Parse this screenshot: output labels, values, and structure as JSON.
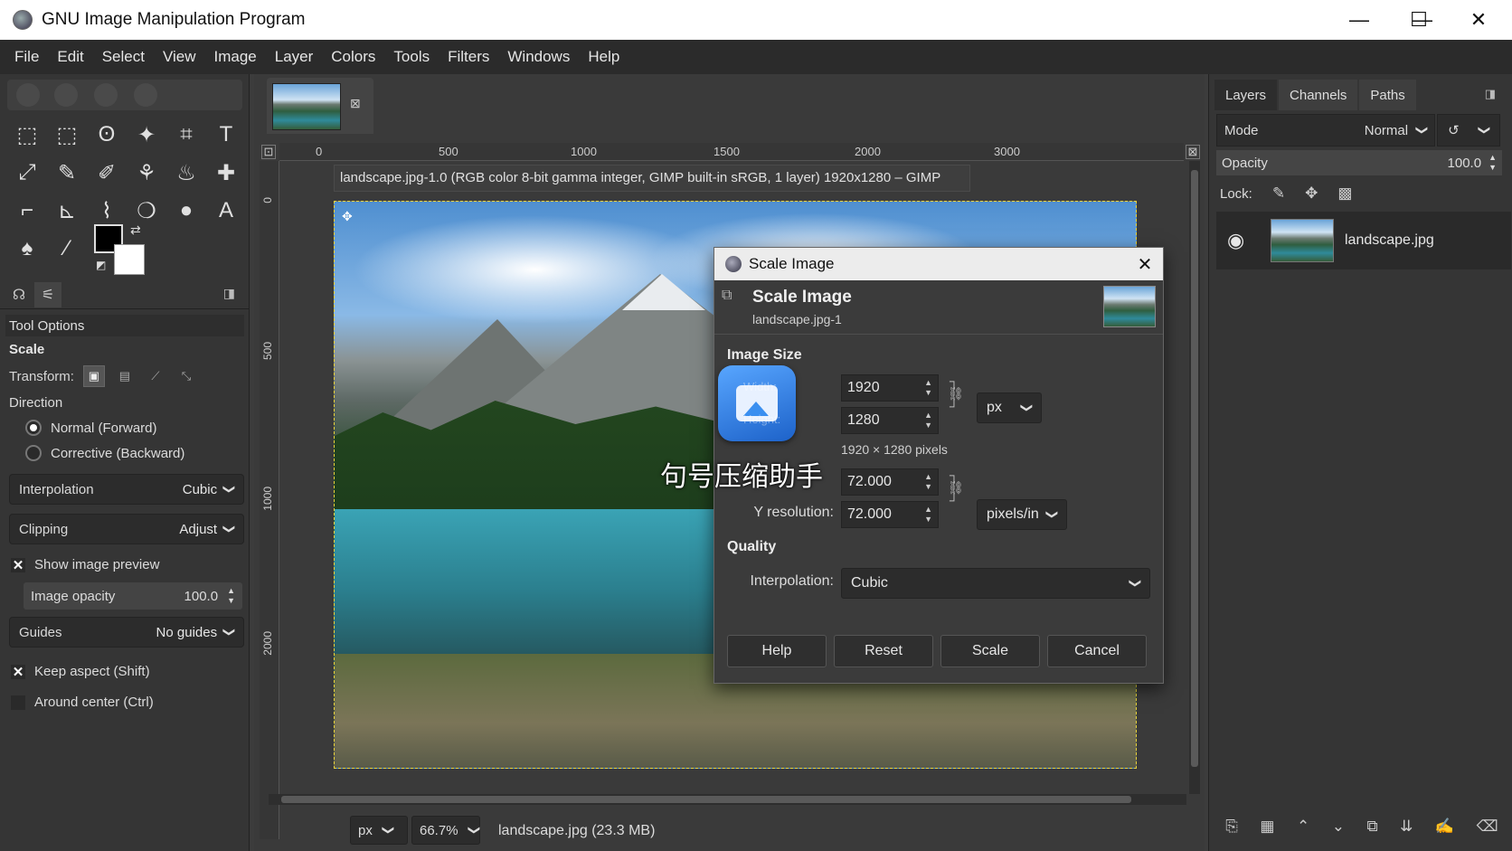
{
  "window": {
    "title": "GNU Image Manipulation Program",
    "controls": [
      "—",
      "☐",
      "✕"
    ]
  },
  "menu": [
    "File",
    "Edit",
    "Select",
    "View",
    "Image",
    "Layer",
    "Colors",
    "Tools",
    "Filters",
    "Windows",
    "Help"
  ],
  "tools": [
    "⬚",
    "⬚",
    "ʘ",
    "✦",
    "⌗",
    "T",
    "⤢",
    "✎",
    "✐",
    "⚘",
    "♨",
    "✚",
    "⌐",
    "⊾",
    "⌇",
    "❍",
    "●",
    "A",
    "♠",
    "⁄"
  ],
  "tool_options": {
    "header": "Tool Options",
    "title": "Scale",
    "transform_label": "Transform:",
    "direction_label": "Direction",
    "direction_normal": "Normal (Forward)",
    "direction_corrective": "Corrective (Backward)",
    "interpolation_label": "Interpolation",
    "interpolation_value": "Cubic",
    "clipping_label": "Clipping",
    "clipping_value": "Adjust",
    "show_preview": "Show image preview",
    "image_opacity_label": "Image opacity",
    "image_opacity_value": "100.0",
    "guides_label": "Guides",
    "guides_value": "No guides",
    "keep_aspect": "Keep aspect (Shift)",
    "around_center": "Around center (Ctrl)"
  },
  "image_window": {
    "info": "landscape.jpg-1.0 (RGB color 8-bit gamma integer, GIMP built-in sRGB, 1 layer) 1920x1280 – GIMP",
    "ruler_h": [
      "0",
      "500",
      "1000",
      "1500",
      "2000",
      "3000"
    ],
    "ruler_v": [
      "0",
      "500",
      "1000",
      "2000"
    ],
    "unit": "px",
    "zoom": "66.7%",
    "status": "landscape.jpg (23.3 MB)"
  },
  "layers_panel": {
    "tabs": [
      "Layers",
      "Channels",
      "Paths"
    ],
    "mode_label": "Mode",
    "mode_value": "Normal",
    "opacity_label": "Opacity",
    "opacity_value": "100.0",
    "lock_label": "Lock:",
    "layer_name": "landscape.jpg"
  },
  "dialog": {
    "window_title": "Scale Image",
    "header_title": "Scale Image",
    "header_sub": "landscape.jpg-1",
    "image_size_label": "Image Size",
    "width_label": "Width:",
    "height_label": "Height:",
    "width_value": "1920",
    "height_value": "1280",
    "size_unit": "px",
    "pixels_info": "1920 × 1280 pixels",
    "x_res_value": "72.000",
    "y_res_label": "Y resolution:",
    "y_res_value": "72.000",
    "res_unit": "pixels/in",
    "quality_label": "Quality",
    "interpolation_label": "Interpolation:",
    "interpolation_value": "Cubic",
    "buttons": {
      "help": "Help",
      "reset": "Reset",
      "scale": "Scale",
      "cancel": "Cancel"
    },
    "watermark": "句号压缩助手"
  }
}
